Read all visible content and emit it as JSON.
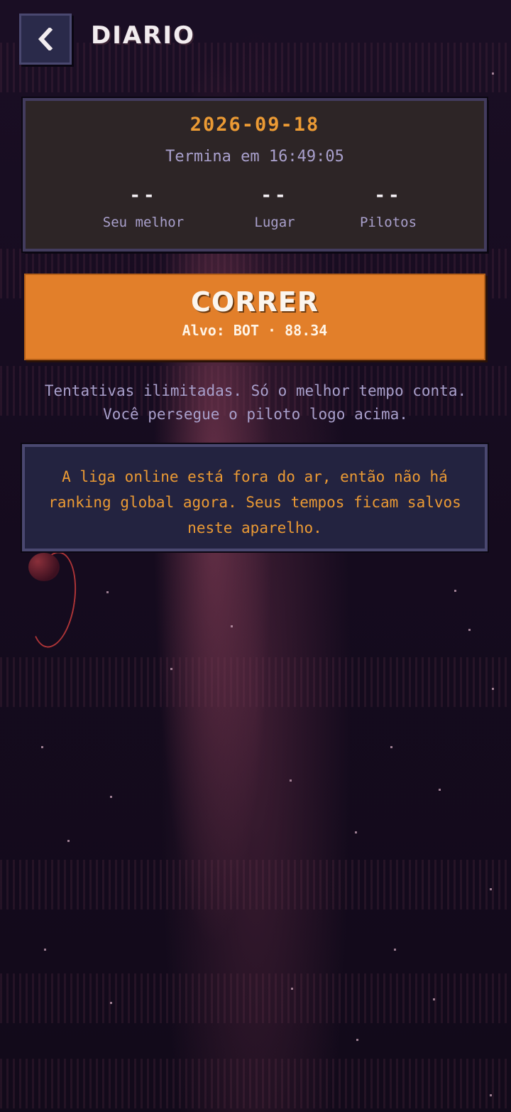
{
  "header": {
    "back_icon": "chevron-left-icon",
    "title": "DIARIO"
  },
  "daily": {
    "date": "2026-09-18",
    "ends_in": "Termina em 16:49:05",
    "stats": [
      {
        "value": "--",
        "label": "Seu melhor"
      },
      {
        "value": "--",
        "label": "Lugar"
      },
      {
        "value": "--",
        "label": "Pilotos"
      }
    ]
  },
  "run_button": {
    "label": "CORRER",
    "target": "Alvo: BOT · 88.34"
  },
  "info": {
    "line1": "Tentativas ilimitadas. Só o melhor tempo conta.",
    "line2": "Você persegue o piloto logo acima."
  },
  "notice": {
    "text": "A liga online está fora do ar, então não há ranking global agora. Seus tempos ficam salvos neste aparelho."
  },
  "colors": {
    "accent": "#e27f2a",
    "date": "#eb9a34",
    "panel": "#2d2526",
    "border": "#433c5e",
    "muted": "#a9a0cc"
  }
}
